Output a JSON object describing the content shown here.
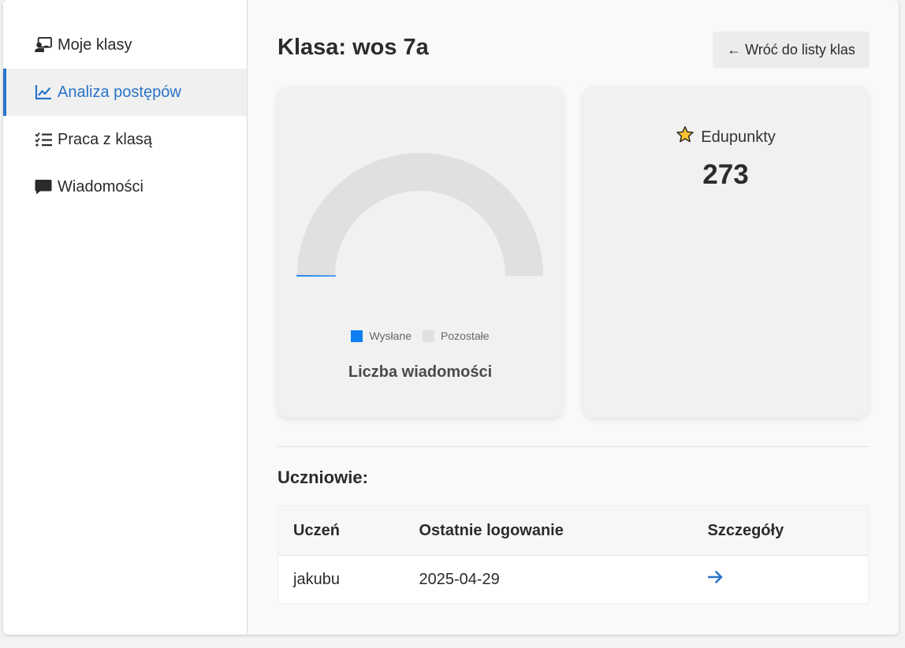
{
  "sidebar": {
    "items": [
      {
        "label": "Moje klasy",
        "icon": "chalkboard-teacher-icon",
        "active": false
      },
      {
        "label": "Analiza postępów",
        "icon": "chart-line-icon",
        "active": true
      },
      {
        "label": "Praca z klasą",
        "icon": "list-check-icon",
        "active": false
      },
      {
        "label": "Wiadomości",
        "icon": "message-icon",
        "active": false
      }
    ]
  },
  "header": {
    "title": "Klasa: wos 7a",
    "back_label": "← Wróć do listy klas"
  },
  "chart_data": {
    "type": "pie",
    "title": "Liczba wiadomości",
    "categories": [
      "Wysłane",
      "Pozostałe"
    ],
    "values": [
      0.2,
      99.8
    ],
    "colors": [
      "#0d7ff2",
      "#e0e0e0"
    ],
    "style": "half-doughnut",
    "legend": "bottom"
  },
  "points": {
    "label": "Edupunkty",
    "value": "273",
    "icon": "star-icon"
  },
  "students": {
    "title": "Uczniowie:",
    "columns": [
      "Uczeń",
      "Ostatnie logowanie",
      "Szczegóły"
    ],
    "rows": [
      {
        "name": "jakubu",
        "last_login": "2025-04-29",
        "details_icon": "arrow-right-icon"
      }
    ]
  },
  "colors": {
    "accent": "#2a73c9",
    "sent": "#0d7ff2",
    "remaining": "#e0e0e0"
  }
}
